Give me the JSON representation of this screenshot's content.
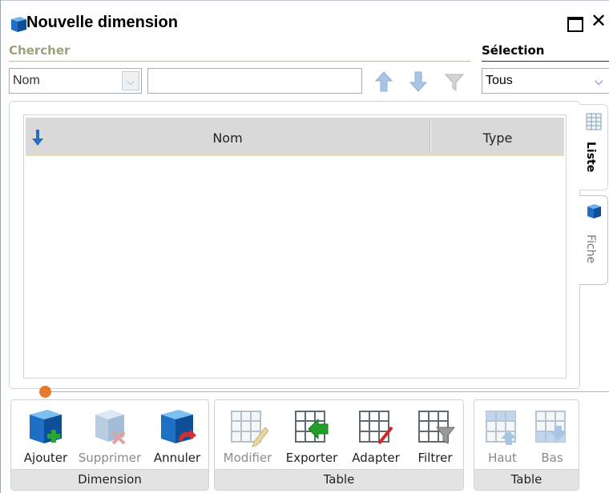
{
  "window": {
    "title": "Nouvelle dimension",
    "maximize_icon": "maximize-icon",
    "close_label": "✕"
  },
  "search": {
    "heading": "Chercher",
    "field_value": "Nom",
    "query_value": "",
    "icons": [
      "arrow-up-icon",
      "arrow-down-icon",
      "funnel-icon"
    ]
  },
  "selection": {
    "heading": "Sélection",
    "value": "Tous"
  },
  "grid": {
    "columns": [
      "Nom",
      "Type"
    ],
    "sort_icon": "sort-down-icon",
    "rows": []
  },
  "tabs": [
    {
      "label": "Liste",
      "icon": "grid-icon",
      "active": true
    },
    {
      "label": "Fiche",
      "icon": "cube-icon",
      "active": false
    }
  ],
  "ribbon": {
    "groups": [
      {
        "label": "Dimension",
        "buttons": [
          {
            "label": "Ajouter",
            "icon": "cube-add-icon",
            "enabled": true
          },
          {
            "label": "Supprimer",
            "icon": "cube-delete-icon",
            "enabled": false
          },
          {
            "label": "Annuler",
            "icon": "cube-undo-icon",
            "enabled": true
          }
        ]
      },
      {
        "label": "Table",
        "buttons": [
          {
            "label": "Modifier",
            "icon": "table-edit-icon",
            "enabled": false
          },
          {
            "label": "Exporter",
            "icon": "table-export-icon",
            "enabled": true
          },
          {
            "label": "Adapter",
            "icon": "table-adapt-icon",
            "enabled": true
          },
          {
            "label": "Filtrer",
            "icon": "table-filter-icon",
            "enabled": true
          }
        ]
      },
      {
        "label": "Table",
        "buttons": [
          {
            "label": "Haut",
            "icon": "table-up-icon",
            "enabled": false
          },
          {
            "label": "Bas",
            "icon": "table-down-icon",
            "enabled": false
          }
        ]
      }
    ]
  },
  "colors": {
    "accent_orange": "#e67a2d",
    "search_heading": "#9aa37a",
    "cube_blue": "#1f6fc4"
  }
}
